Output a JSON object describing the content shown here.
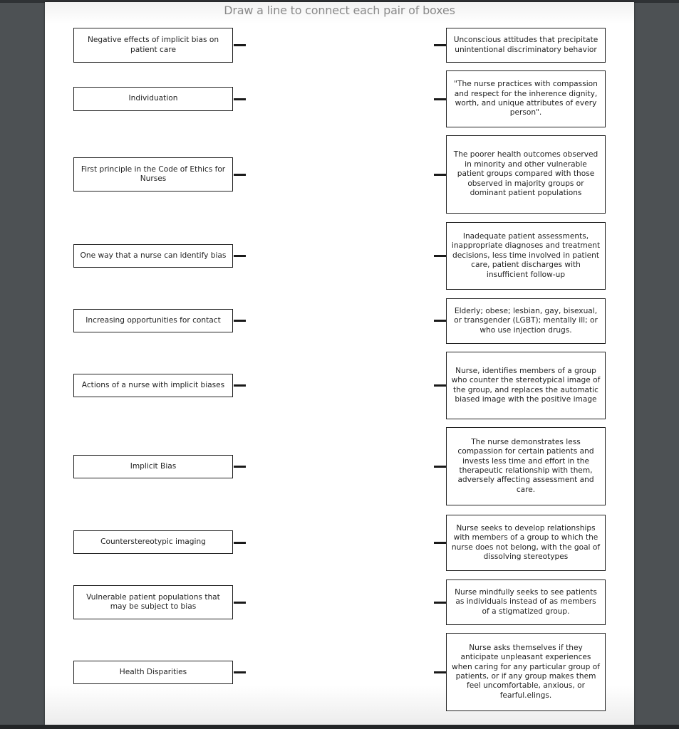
{
  "title": "Draw a line to connect each pair of boxes",
  "left_items": [
    {
      "label": "Negative effects of implicit bias on patient care"
    },
    {
      "label": "Individuation"
    },
    {
      "label": "First principle in the Code of Ethics for Nurses"
    },
    {
      "label": "One way that a nurse can identify bias"
    },
    {
      "label": "Increasing opportunities for contact"
    },
    {
      "label": "Actions of a nurse with implicit biases"
    },
    {
      "label": "Implicit Bias"
    },
    {
      "label": "Counterstereotypic imaging"
    },
    {
      "label": "Vulnerable patient populations that may be subject to bias"
    },
    {
      "label": "Health Disparities"
    }
  ],
  "right_items": [
    {
      "label": "Unconscious attitudes that precipitate unintentional discriminatory behavior"
    },
    {
      "label": "\"The nurse practices with compassion and respect for the inherence dignity, worth, and unique attributes of every person\"."
    },
    {
      "label": "The poorer health outcomes observed in minority and other vulnerable patient groups compared with those observed in majority groups or dominant patient populations"
    },
    {
      "label": "Inadequate patient assessments, inappropriate diagnoses and treatment decisions, less time involved in patient care, patient discharges with insufficient follow-up"
    },
    {
      "label": "Elderly; obese; lesbian, gay, bisexual, or transgender (LGBT); mentally ill; or who use injection drugs."
    },
    {
      "label": "Nurse, identifies members of a group who counter the stereotypical image of the group, and replaces the automatic biased image with the positive image"
    },
    {
      "label": "The nurse demonstrates less compassion for certain patients and invests less time and effort in the therapeutic relationship with them, adversely affecting assessment and care."
    },
    {
      "label": "Nurse seeks to develop relationships with members of a group to which the nurse does not belong, with the goal of dissolving stereotypes"
    },
    {
      "label": "Nurse mindfully seeks to see patients as individuals instead of as members of a stigmatized group."
    },
    {
      "label": "Nurse asks themselves if they anticipate unpleasant experiences when caring for any particular group of patients, or if any group makes them feel uncomfortable, anxious, or fearful.elings."
    }
  ]
}
